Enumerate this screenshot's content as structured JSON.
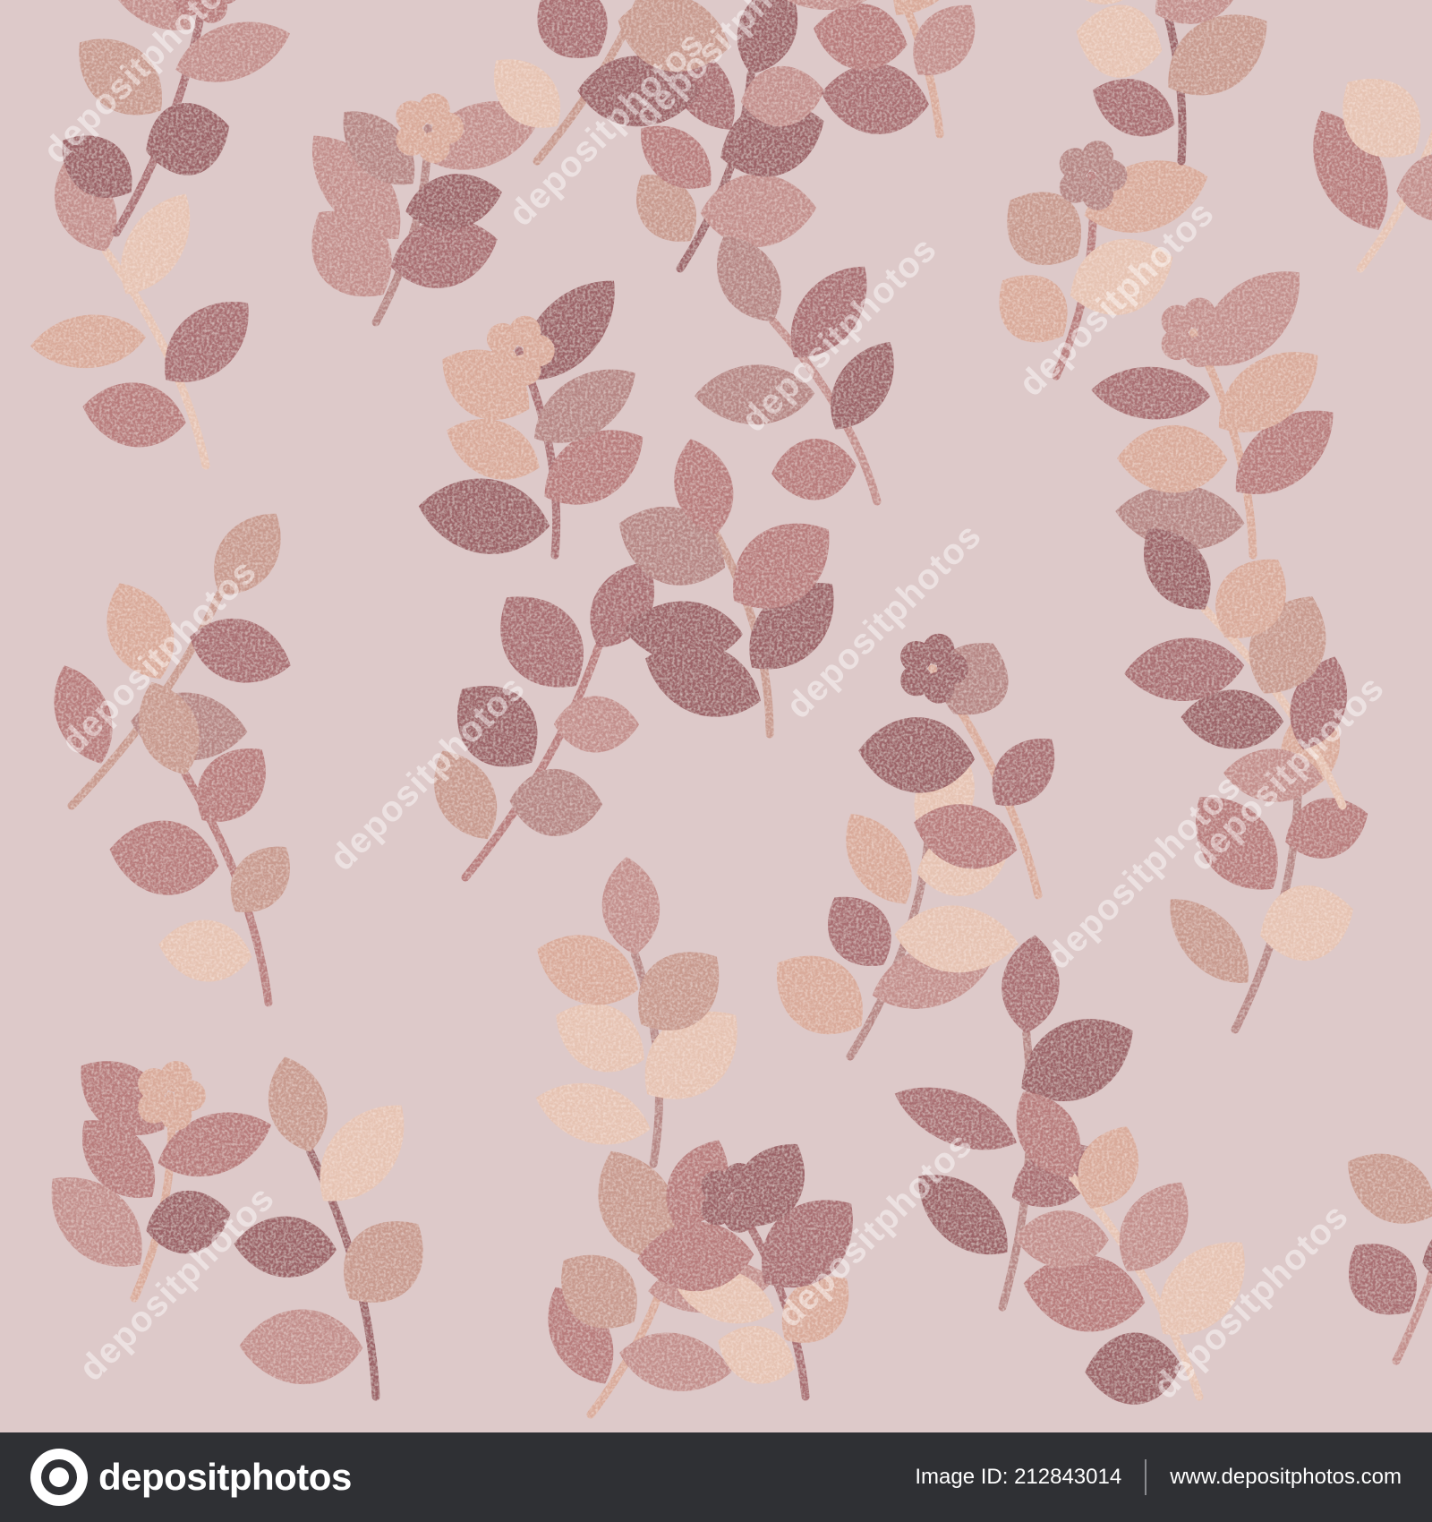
{
  "colors": {
    "background": "#ddc9c9",
    "leaf_palette": [
      "#b87c7c",
      "#c38f8c",
      "#a96e72",
      "#d9aa9a",
      "#e6c3b2",
      "#c89a8e",
      "#9c6468",
      "#b68684"
    ],
    "footer_bg": "#2f3034",
    "footer_text": "#ffffff"
  },
  "watermark": {
    "text": "depositphotos"
  },
  "footer": {
    "brand_icon": "depositphotos-logo-icon",
    "brand_name": "depositphotos",
    "image_id_label": "Image ID: 212843014",
    "site_url": "www.depositphotos.com"
  }
}
